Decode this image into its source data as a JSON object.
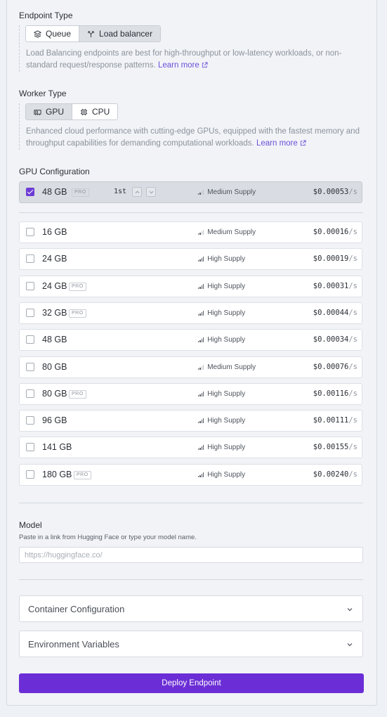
{
  "endpoint_type": {
    "label": "Endpoint Type",
    "options": [
      "Queue",
      "Load balancer"
    ],
    "selected": "Load balancer",
    "description": "Load Balancing endpoints are best for high-throughput or low-latency workloads, or non-standard request/response patterns.",
    "learn_more": "Learn more"
  },
  "worker_type": {
    "label": "Worker Type",
    "options": [
      "GPU",
      "CPU"
    ],
    "selected": "GPU",
    "description": "Enhanced cloud performance with cutting-edge GPUs, equipped with the fastest memory and throughput capabilities for demanding computational workloads.",
    "learn_more": "Learn more"
  },
  "gpu_config": {
    "label": "GPU Configuration",
    "pro_badge": "PRO",
    "price_unit": "/s",
    "selected": {
      "memory": "48 GB",
      "pro": true,
      "rank": "1st",
      "supply": "Medium Supply",
      "supply_level": 2,
      "price": "$0.00053"
    },
    "options": [
      {
        "memory": "16 GB",
        "pro": false,
        "supply": "Medium Supply",
        "supply_level": 2,
        "price": "$0.00016"
      },
      {
        "memory": "24 GB",
        "pro": false,
        "supply": "High Supply",
        "supply_level": 4,
        "price": "$0.00019"
      },
      {
        "memory": "24 GB",
        "pro": true,
        "supply": "High Supply",
        "supply_level": 4,
        "price": "$0.00031"
      },
      {
        "memory": "32 GB",
        "pro": true,
        "supply": "High Supply",
        "supply_level": 4,
        "price": "$0.00044"
      },
      {
        "memory": "48 GB",
        "pro": false,
        "supply": "High Supply",
        "supply_level": 4,
        "price": "$0.00034"
      },
      {
        "memory": "80 GB",
        "pro": false,
        "supply": "Medium Supply",
        "supply_level": 2,
        "price": "$0.00076"
      },
      {
        "memory": "80 GB",
        "pro": true,
        "supply": "High Supply",
        "supply_level": 4,
        "price": "$0.00116"
      },
      {
        "memory": "96 GB",
        "pro": false,
        "supply": "High Supply",
        "supply_level": 4,
        "price": "$0.00111"
      },
      {
        "memory": "141 GB",
        "pro": false,
        "supply": "High Supply",
        "supply_level": 4,
        "price": "$0.00155"
      },
      {
        "memory": "180 GB",
        "pro": true,
        "supply": "High Supply",
        "supply_level": 4,
        "price": "$0.00240"
      }
    ]
  },
  "model": {
    "label": "Model",
    "hint": "Paste in a link from Hugging Face or type your model name.",
    "value": "",
    "placeholder": "https://huggingface.co/"
  },
  "container_config": {
    "label": "Container Configuration"
  },
  "env_vars": {
    "label": "Environment Variables"
  },
  "deploy_button": {
    "label": "Deploy Endpoint"
  },
  "colors": {
    "accent": "#6b2ed6",
    "link": "#6d4fd8"
  }
}
